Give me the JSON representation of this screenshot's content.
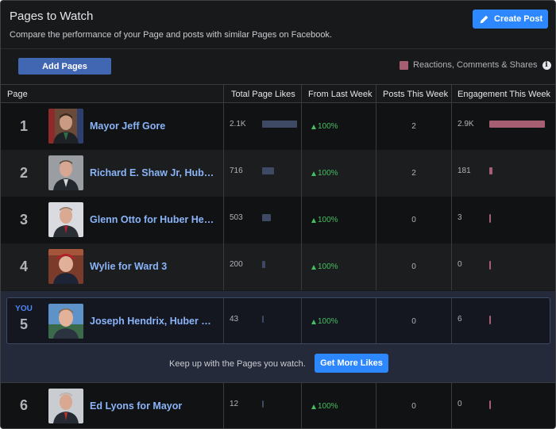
{
  "header": {
    "title": "Pages to Watch",
    "subtitle": "Compare the performance of your Page and posts with similar Pages on Facebook.",
    "create_post_label": "Create Post"
  },
  "toolbar": {
    "add_pages_label": "Add Pages",
    "legend_label": "Reactions, Comments & Shares",
    "legend_color": "#a65e72",
    "info_icon": "info-icon"
  },
  "table": {
    "columns": [
      "Page",
      "Total Page Likes",
      "From Last Week",
      "Posts This Week",
      "Engagement This Week"
    ],
    "rows": [
      {
        "rank": "1",
        "name": "Mayor Jeff Gore",
        "likes": "2.1K",
        "likes_fraction": 1.0,
        "from_last_week": "100%",
        "posts": "2",
        "engagement": "2.9K",
        "engagement_fraction": 1.0
      },
      {
        "rank": "2",
        "name": "Richard E. Shaw Jr, Hub…",
        "likes": "716",
        "likes_fraction": 0.34,
        "from_last_week": "100%",
        "posts": "2",
        "engagement": "181",
        "engagement_fraction": 0.06
      },
      {
        "rank": "3",
        "name": "Glenn Otto for Huber He…",
        "likes": "503",
        "likes_fraction": 0.24,
        "from_last_week": "100%",
        "posts": "0",
        "engagement": "3",
        "engagement_fraction": 0.001
      },
      {
        "rank": "4",
        "name": "Wylie for Ward 3",
        "likes": "200",
        "likes_fraction": 0.095,
        "from_last_week": "100%",
        "posts": "0",
        "engagement": "0",
        "engagement_fraction": 0.0
      },
      {
        "rank": "5",
        "you": "YOU",
        "name": "Joseph Hendrix, Huber …",
        "likes": "43",
        "likes_fraction": 0.02,
        "from_last_week": "100%",
        "posts": "0",
        "engagement": "6",
        "engagement_fraction": 0.002
      },
      {
        "rank": "6",
        "name": "Ed Lyons for Mayor",
        "likes": "12",
        "likes_fraction": 0.006,
        "from_last_week": "100%",
        "posts": "0",
        "engagement": "0",
        "engagement_fraction": 0.0
      }
    ]
  },
  "cta": {
    "text": "Keep up with the Pages you watch.",
    "button_label": "Get More Likes"
  },
  "colors": {
    "accent": "#2d88ff",
    "brand_button": "#4267b2",
    "link": "#8ab4f8",
    "positive": "#45bd62",
    "likes_bar": "#3e4a63",
    "engagement_bar": "#a65e72"
  }
}
